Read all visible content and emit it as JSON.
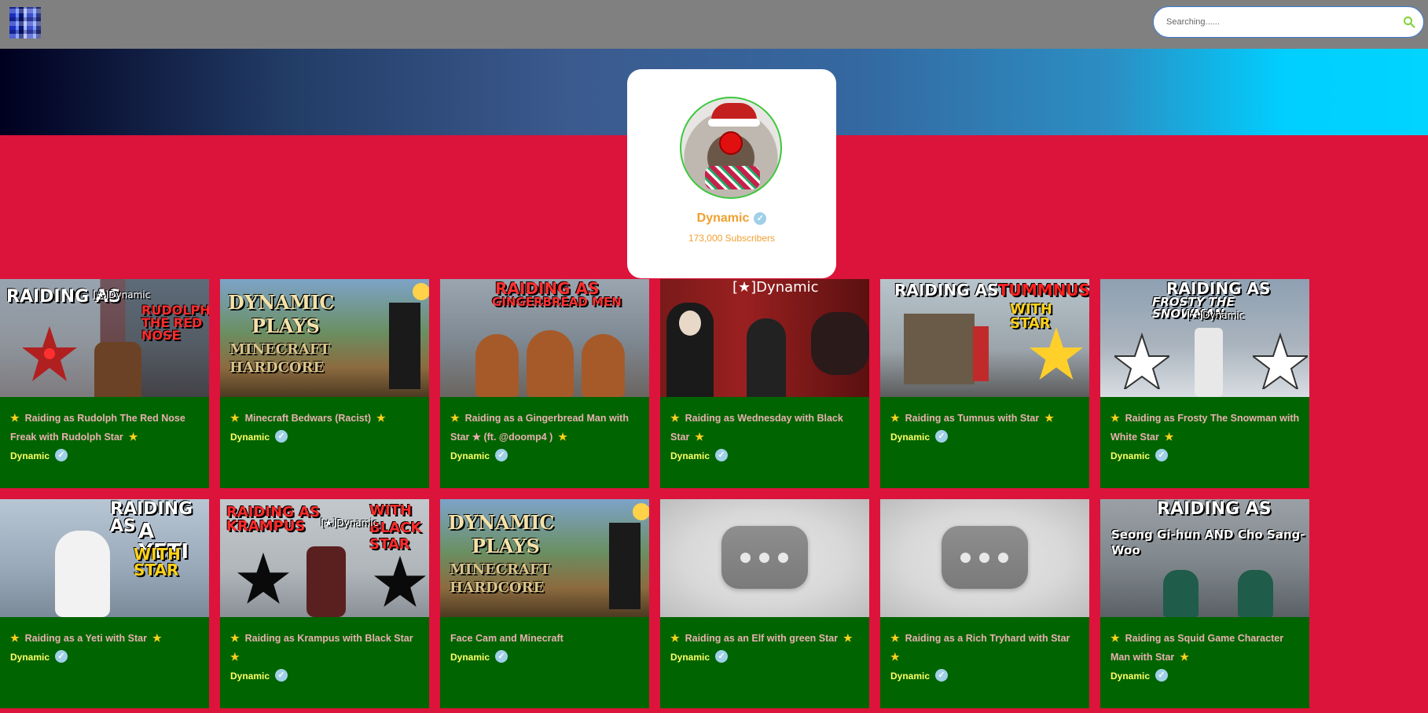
{
  "search": {
    "placeholder": "Searching......"
  },
  "channel": {
    "name": "Dynamic",
    "subscribers": "173,000 Subscribers",
    "verified_icon": "check-circle-icon"
  },
  "colors": {
    "page_bg": "#dc143c",
    "topbar": "#808080",
    "card_bg": "#006400",
    "accent": "#f0a030",
    "title_text": "#e8b0b0",
    "channel_text": "#ffff66",
    "star": "#ffd21a"
  },
  "videos": [
    {
      "title": "Raiding as Rudolph The Red Nose Freak with Rudolph Star",
      "star_before": "★",
      "star_after": "★",
      "channel": "Dynamic",
      "thumb_text_1": "RAIDING AS",
      "thumb_text_2": "[★]Dynamic",
      "thumb_text_3": "RUDOLPH THE RED NOSE"
    },
    {
      "title": "Minecraft Bedwars (Racist)",
      "star_before": "★",
      "star_after": "★",
      "channel": "Dynamic",
      "thumb_text_1": "DYNAMIC",
      "thumb_text_2": "PLAYS",
      "thumb_text_3": "MINECRAFT HARDCORE"
    },
    {
      "title": "Raiding as a Gingerbread Man with Star ★ (ft. @doomp4 )",
      "star_before": "★",
      "star_after": "★",
      "channel": "Dynamic",
      "thumb_text_1": "RAIDING AS",
      "thumb_text_2": "GINGERBREAD MEN",
      "thumb_text_3": ""
    },
    {
      "title": "Raiding as Wednesday with Black Star",
      "star_before": "★",
      "star_after": "★",
      "channel": "Dynamic",
      "thumb_text_1": "[★]Dynamic",
      "thumb_text_2": "",
      "thumb_text_3": ""
    },
    {
      "title": "Raiding as Tumnus with Star",
      "star_before": "★",
      "star_after": "★",
      "channel": "Dynamic",
      "thumb_text_1": "RAIDING AS",
      "thumb_text_2": "TUMMNUS",
      "thumb_text_3": "WITH STAR"
    },
    {
      "title": "Raiding as Frosty The Snowman with White Star",
      "star_before": "★",
      "star_after": "★",
      "channel": "Dynamic",
      "thumb_text_1": "RAIDING AS",
      "thumb_text_2": "FROSTY THE SNOWMAN",
      "thumb_text_3": "[★]Dynamic"
    },
    {
      "title": "Raiding as a Yeti with Star",
      "star_before": "★",
      "star_after": "★",
      "channel": "Dynamic",
      "thumb_text_1": "RAIDING AS",
      "thumb_text_2": "A YETI",
      "thumb_text_3": "WITH STAR"
    },
    {
      "title": "Raiding as Krampus with Black Star",
      "star_before": "★",
      "star_after": "★",
      "channel": "Dynamic",
      "thumb_text_1": "RAIDING AS KRAMPUS",
      "thumb_text_2": "WITH BLACK STAR",
      "thumb_text_3": "[★]Dynamic"
    },
    {
      "title": "Face Cam and Minecraft",
      "star_before": "",
      "star_after": "",
      "channel": "Dynamic",
      "thumb_text_1": "DYNAMIC",
      "thumb_text_2": "PLAYS",
      "thumb_text_3": "MINECRAFT HARDCORE"
    },
    {
      "title": "Raiding as an Elf with green Star",
      "star_before": "★",
      "star_after": "★",
      "channel": "Dynamic",
      "thumb_text_1": "",
      "thumb_text_2": "",
      "thumb_text_3": ""
    },
    {
      "title": "Raiding as a Rich Tryhard with Star",
      "star_before": "★",
      "star_after": "★",
      "channel": "Dynamic",
      "thumb_text_1": "",
      "thumb_text_2": "",
      "thumb_text_3": ""
    },
    {
      "title": "Raiding as Squid Game Character Man with Star",
      "star_before": "★",
      "star_after": "★",
      "channel": "Dynamic",
      "thumb_text_1": "RAIDING AS",
      "thumb_text_2": "Seong Gi-hun AND Cho Sang-Woo",
      "thumb_text_3": ""
    }
  ]
}
